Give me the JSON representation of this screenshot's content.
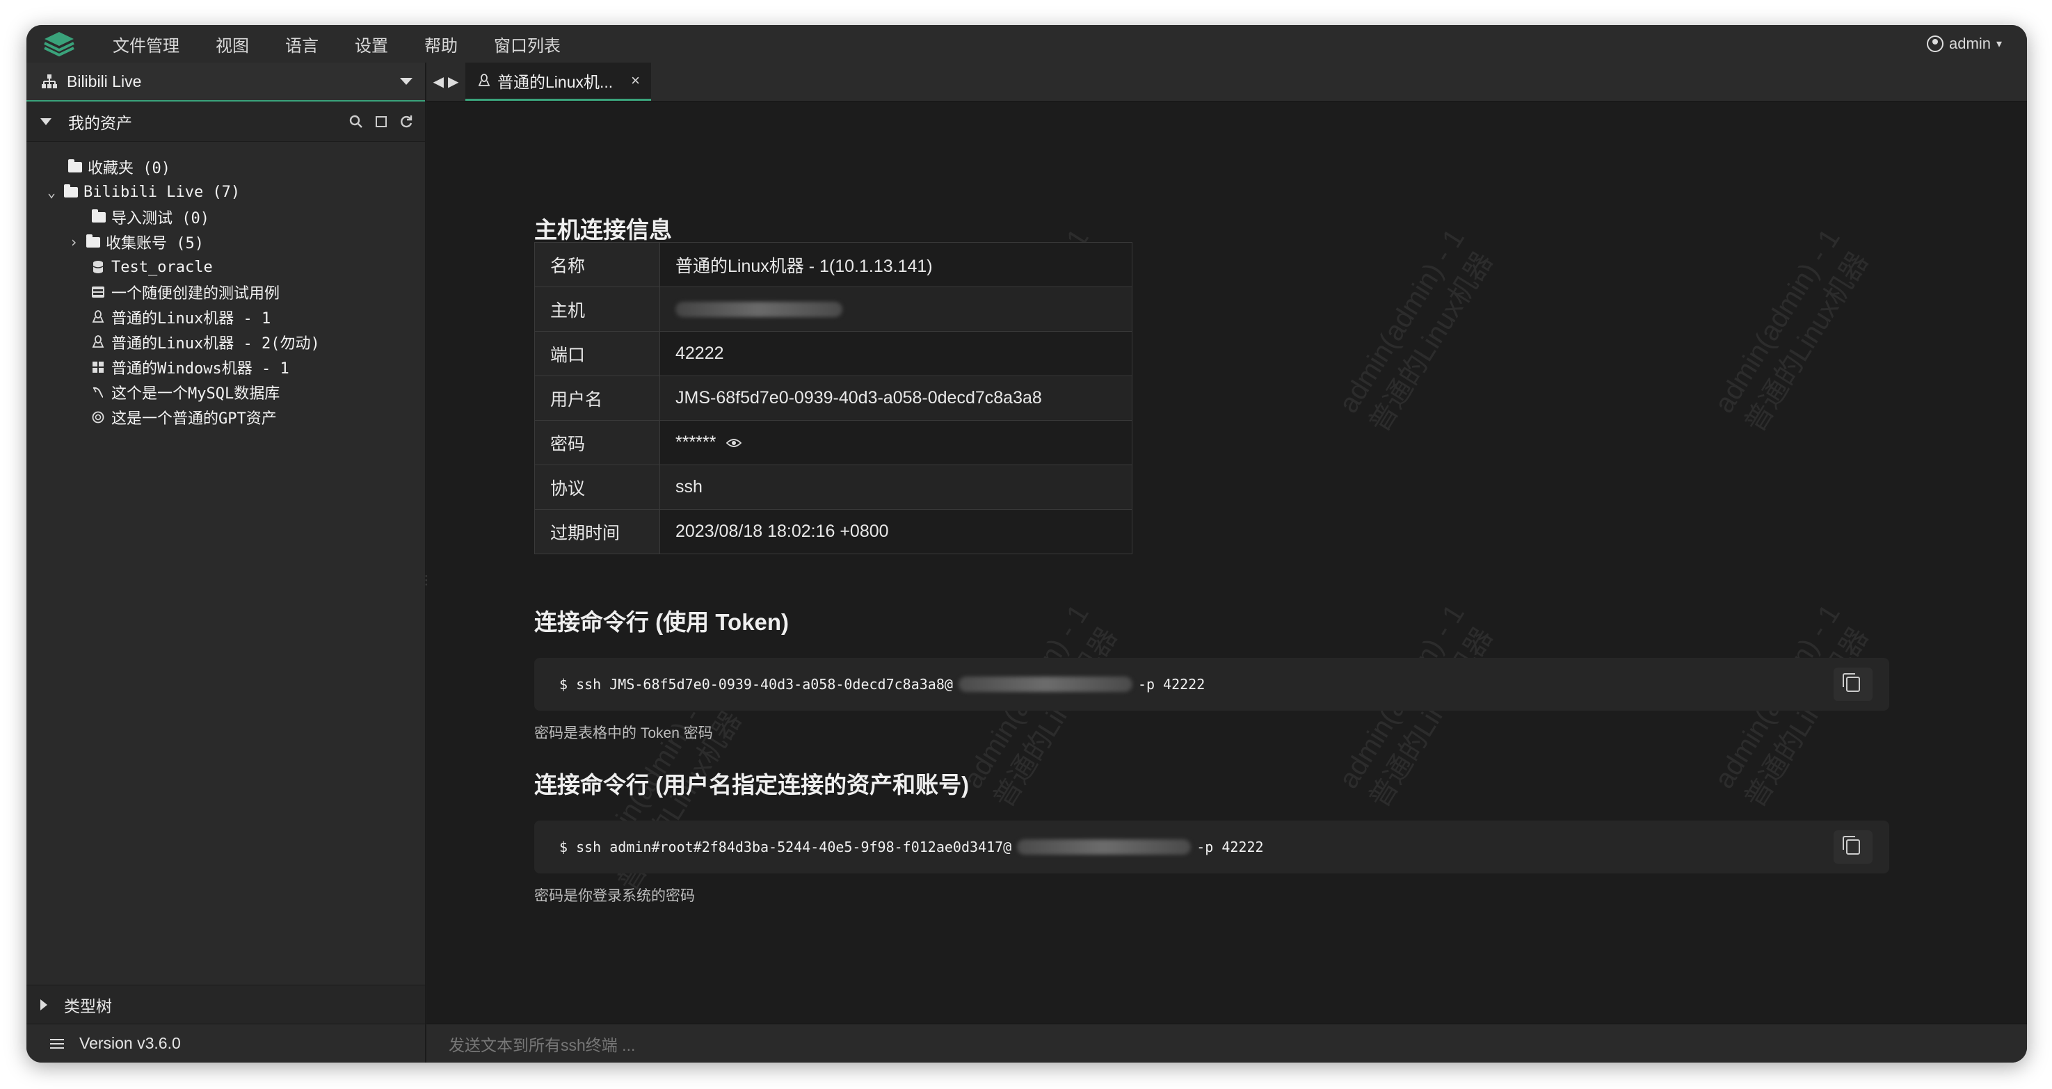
{
  "menubar": {
    "items": [
      "文件管理",
      "视图",
      "语言",
      "设置",
      "帮助",
      "窗口列表"
    ],
    "user": "admin"
  },
  "sidebar": {
    "project": "Bilibili Live",
    "assets_title": "我的资产",
    "tree": [
      {
        "label": "收藏夹 (0)",
        "icon": "folder-icon",
        "arrow": ""
      },
      {
        "label": "Bilibili Live (7)",
        "icon": "folder-open-icon",
        "arrow": "⌄"
      },
      {
        "label": "导入测试 (0)",
        "icon": "folder-icon",
        "arrow": ""
      },
      {
        "label": "收集账号 (5)",
        "icon": "folder-icon",
        "arrow": "›"
      },
      {
        "label": "Test_oracle",
        "icon": "database-icon",
        "arrow": ""
      },
      {
        "label": "一个随便创建的测试用例",
        "icon": "terminal-icon",
        "arrow": ""
      },
      {
        "label": "普通的Linux机器 - 1",
        "icon": "linux-icon",
        "arrow": ""
      },
      {
        "label": "普通的Linux机器 - 2(勿动)",
        "icon": "linux-icon",
        "arrow": ""
      },
      {
        "label": "普通的Windows机器 - 1",
        "icon": "windows-icon",
        "arrow": ""
      },
      {
        "label": "这个是一个MySQL数据库",
        "icon": "mysql-icon",
        "arrow": ""
      },
      {
        "label": "这是一个普通的GPT资产",
        "icon": "gpt-icon",
        "arrow": ""
      }
    ],
    "type_tree": "类型树",
    "version": "Version v3.6.0"
  },
  "tab": {
    "label": "普通的Linux机...",
    "close": "×"
  },
  "connection": {
    "title": "主机连接信息",
    "rows": [
      {
        "key": "名称",
        "value": "普通的Linux机器 - 1(10.1.13.141)"
      },
      {
        "key": "主机",
        "value": ""
      },
      {
        "key": "端口",
        "value": "42222"
      },
      {
        "key": "用户名",
        "value": "JMS-68f5d7e0-0939-40d3-a058-0decd7c8a3a8"
      },
      {
        "key": "密码",
        "value": "******"
      },
      {
        "key": "协议",
        "value": "ssh"
      },
      {
        "key": "过期时间",
        "value": "2023/08/18 18:02:16 +0800"
      }
    ]
  },
  "token_cmd": {
    "title": "连接命令行 (使用 Token)",
    "prefix": "$ ssh JMS-68f5d7e0-0939-40d3-a058-0decd7c8a3a8@",
    "suffix": "-p 42222",
    "hint": "密码是表格中的 Token 密码"
  },
  "user_cmd": {
    "title": "连接命令行 (用户名指定连接的资产和账号)",
    "prefix": "$ ssh admin#root#2f84d3ba-5244-40e5-9f98-f012ae0d3417@",
    "suffix": "-p 42222",
    "hint": "密码是你登录系统的密码"
  },
  "watermark": {
    "line1": "admin(admin) - 1",
    "line2": "普通的Linux机器"
  },
  "footer": {
    "placeholder": "发送文本到所有ssh终端 ..."
  },
  "colors": {
    "accent": "#3aa37b",
    "bg": "#1c1c1c",
    "panel": "#2a2a2a"
  }
}
